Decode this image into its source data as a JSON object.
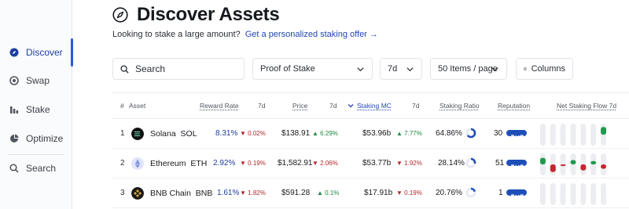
{
  "sidebar": {
    "items": [
      {
        "label": "Discover",
        "icon": "compass-icon",
        "active": true
      },
      {
        "label": "Swap",
        "icon": "swap-icon",
        "active": false
      },
      {
        "label": "Stake",
        "icon": "stake-icon",
        "active": false
      },
      {
        "label": "Optimize",
        "icon": "optimize-icon",
        "active": false
      },
      {
        "label": "Search",
        "icon": "search-icon",
        "active": false
      }
    ]
  },
  "header": {
    "title": "Discover Assets",
    "subtitle": "Looking to stake a large amount?",
    "cta": "Get a personalized staking offer →"
  },
  "filters": {
    "search_placeholder": "Search",
    "consensus": "Proof of Stake",
    "period": "7d",
    "page_size": "50 Items / page",
    "columns": "Columns"
  },
  "table": {
    "headers": {
      "rank": "#",
      "asset": "Asset",
      "reward_rate": "Reward Rate",
      "reward_period": "7d",
      "price": "Price",
      "price_period": "7d",
      "staking_mc": "Staking MC",
      "mc_period": "7d",
      "staking_ratio": "Staking Ratio",
      "reputation": "Reputation",
      "net_flow": "Net Staking Flow 7d"
    },
    "rows": [
      {
        "rank": "1",
        "name": "Solana",
        "symbol": "SOL",
        "logo_color": "#111111",
        "reward_rate": "8.31%",
        "reward_change": "0.02%",
        "reward_dir": "down",
        "price": "$138.91",
        "price_change": "6.29%",
        "price_dir": "up",
        "staking_mc": "$53.96b",
        "mc_change": "7.77%",
        "mc_dir": "up",
        "staking_ratio": "64.86%",
        "ratio_fraction": 0.6486,
        "reputation": "30",
        "flow": [
          0,
          0,
          0,
          0,
          0,
          0,
          0.7
        ]
      },
      {
        "rank": "2",
        "name": "Ethereum",
        "symbol": "ETH",
        "logo_color": "#8a9ae0",
        "reward_rate": "2.92%",
        "reward_change": "0.19%",
        "reward_dir": "down",
        "price": "$1,582.91",
        "price_change": "2.06%",
        "price_dir": "down",
        "staking_mc": "$53.77b",
        "mc_change": "1.92%",
        "mc_dir": "down",
        "staking_ratio": "28.14%",
        "ratio_fraction": 0.2814,
        "reputation": "51",
        "flow": [
          0.6,
          -0.7,
          -0.15,
          0.4,
          -0.55,
          0.3,
          -0.4
        ]
      },
      {
        "rank": "3",
        "name": "BNB Chain",
        "symbol": "BNB",
        "logo_color": "#1a1a1a",
        "reward_rate": "1.61%",
        "reward_change": "1.82%",
        "reward_dir": "down",
        "price": "$591.28",
        "price_change": "0.1%",
        "price_dir": "up",
        "staking_mc": "$17.91b",
        "mc_change": "0.19%",
        "mc_dir": "down",
        "staking_ratio": "20.76%",
        "ratio_fraction": 0.2076,
        "reputation": "1",
        "flow": [
          0,
          0,
          0,
          0,
          0,
          0,
          0
        ]
      }
    ]
  }
}
